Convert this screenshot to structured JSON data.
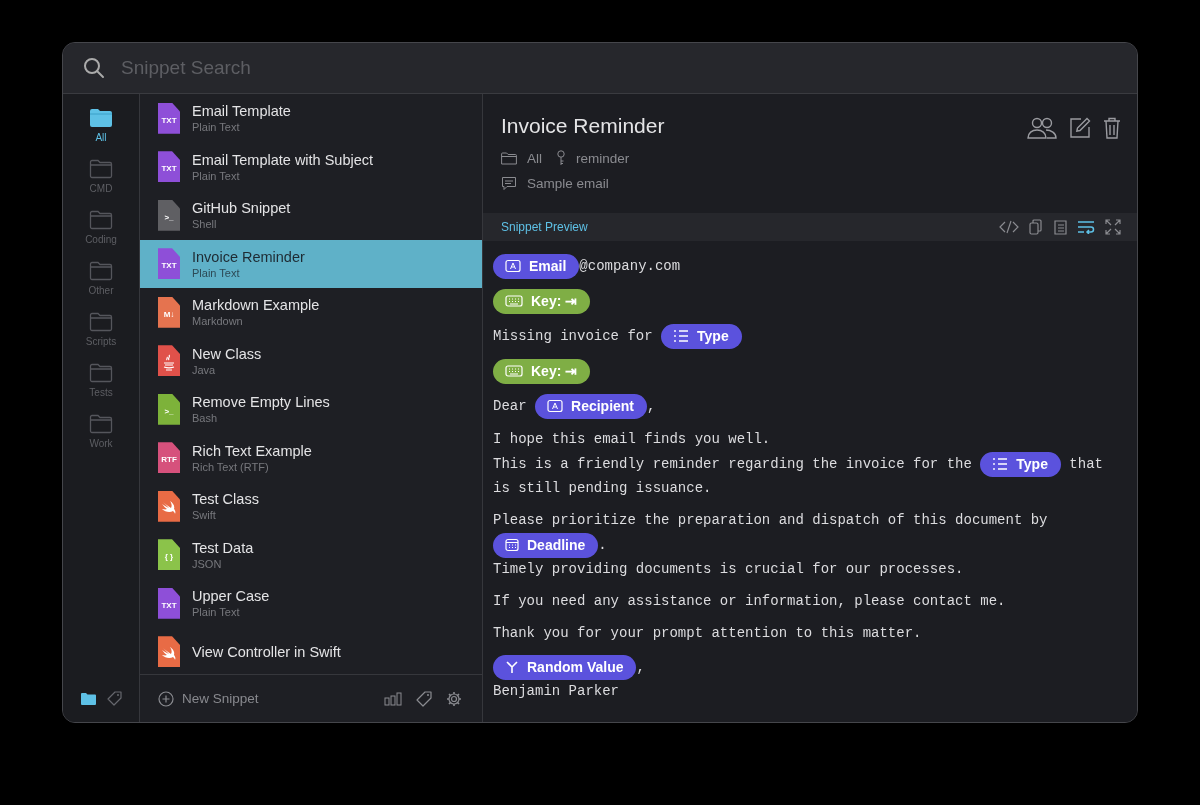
{
  "search": {
    "placeholder": "Snippet Search"
  },
  "folders": [
    {
      "label": "All",
      "selected": true
    },
    {
      "label": "CMD",
      "selected": false
    },
    {
      "label": "Coding",
      "selected": false
    },
    {
      "label": "Other",
      "selected": false
    },
    {
      "label": "Scripts",
      "selected": false
    },
    {
      "label": "Tests",
      "selected": false
    },
    {
      "label": "Work",
      "selected": false
    }
  ],
  "sidebar_tabs": [
    {
      "kind": "folders",
      "selected": true
    },
    {
      "kind": "tags",
      "selected": false
    }
  ],
  "snippets": [
    {
      "name": "Email Template",
      "language": "Plain Text",
      "selected": false,
      "icon": {
        "kind": "label",
        "label": "TXT",
        "color": "#8e4fd8"
      }
    },
    {
      "name": "Email Template with Subject",
      "language": "Plain Text",
      "selected": false,
      "icon": {
        "kind": "label",
        "label": "TXT",
        "color": "#8e4fd8"
      }
    },
    {
      "name": "GitHub Snippet",
      "language": "Shell",
      "selected": false,
      "icon": {
        "kind": "label",
        "label": ">_",
        "color": "#5f5f63"
      }
    },
    {
      "name": "Invoice Reminder",
      "language": "Plain Text",
      "selected": true,
      "icon": {
        "kind": "label",
        "label": "TXT",
        "color": "#8e4fd8"
      }
    },
    {
      "name": "Markdown Example",
      "language": "Markdown",
      "selected": false,
      "icon": {
        "kind": "label",
        "label": "M↓",
        "color": "#e5734f"
      }
    },
    {
      "name": "New Class",
      "language": "Java",
      "selected": false,
      "icon": {
        "kind": "java",
        "color": "#e0514a"
      }
    },
    {
      "name": "Remove Empty Lines",
      "language": "Bash",
      "selected": false,
      "icon": {
        "kind": "label",
        "label": ">_",
        "color": "#7db23a"
      }
    },
    {
      "name": "Rich Text Example",
      "language": "Rich Text (RTF)",
      "selected": false,
      "icon": {
        "kind": "label",
        "label": "RTF",
        "color": "#d6517c"
      }
    },
    {
      "name": "Test Class",
      "language": "Swift",
      "selected": false,
      "icon": {
        "kind": "swift",
        "color": "#e86b45"
      }
    },
    {
      "name": "Test Data",
      "language": "JSON",
      "selected": false,
      "icon": {
        "kind": "label",
        "label": "{ }",
        "color": "#8bc34a"
      }
    },
    {
      "name": "Upper Case",
      "language": "Plain Text",
      "selected": false,
      "icon": {
        "kind": "label",
        "label": "TXT",
        "color": "#8e4fd8"
      }
    },
    {
      "name": "View Controller in Swift",
      "selected": false,
      "icon": {
        "kind": "swift",
        "color": "#e86b45"
      }
    }
  ],
  "list_footer": {
    "new_button": "New Snippet"
  },
  "detail": {
    "title": "Invoice Reminder",
    "folder": "All",
    "keyword": "reminder",
    "description": "Sample email"
  },
  "preview": {
    "label": "Snippet Preview",
    "tools": [
      {
        "kind": "code",
        "on": false
      },
      {
        "kind": "copy",
        "on": false
      },
      {
        "kind": "list",
        "on": false
      },
      {
        "kind": "wrap",
        "on": true
      },
      {
        "kind": "expand",
        "on": false
      }
    ],
    "paragraphs": [
      [
        [
          {
            "kind": "field",
            "label": "Email"
          },
          {
            "kind": "text",
            "text": "@company.com"
          }
        ]
      ],
      [
        [
          {
            "kind": "key",
            "label": "Key: ⇥"
          }
        ]
      ],
      [
        [
          {
            "kind": "text",
            "text": "Missing invoice for "
          },
          {
            "kind": "list",
            "label": "Type"
          }
        ]
      ],
      [
        [
          {
            "kind": "key",
            "label": "Key: ⇥"
          }
        ]
      ],
      [
        [
          {
            "kind": "text",
            "text": "Dear "
          },
          {
            "kind": "field",
            "label": "Recipient"
          },
          {
            "kind": "text",
            "text": ","
          }
        ]
      ],
      [
        [
          {
            "kind": "text",
            "text": "I hope this email finds you well."
          }
        ],
        [
          {
            "kind": "text",
            "text": "This is a friendly reminder regarding the invoice for the "
          },
          {
            "kind": "list",
            "label": "Type"
          },
          {
            "kind": "text",
            "text": " that"
          }
        ],
        [
          {
            "kind": "text",
            "text": "is still pending issuance."
          }
        ]
      ],
      [
        [
          {
            "kind": "text",
            "text": "Please prioritize the preparation and dispatch of this document by"
          }
        ],
        [
          {
            "kind": "calendar",
            "label": "Deadline"
          },
          {
            "kind": "text",
            "text": "."
          }
        ],
        [
          {
            "kind": "text",
            "text": "Timely providing documents is crucial for our processes."
          }
        ]
      ],
      [
        [
          {
            "kind": "text",
            "text": "If you need any assistance or information, please contact me."
          }
        ]
      ],
      [
        [
          {
            "kind": "text",
            "text": "Thank you for your prompt attention to this matter."
          }
        ]
      ],
      [
        [
          {
            "kind": "random",
            "label": "Random Value"
          },
          {
            "kind": "text",
            "text": ","
          }
        ],
        [
          {
            "kind": "text",
            "text": "Benjamin Parker"
          }
        ]
      ]
    ]
  }
}
